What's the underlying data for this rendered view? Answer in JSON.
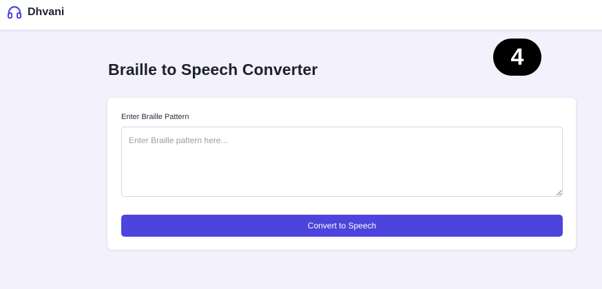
{
  "app": {
    "name": "Dhvani",
    "logo_icon": "headphones-icon",
    "accent_color": "#4c44dc"
  },
  "badge": {
    "text": "4"
  },
  "main": {
    "title": "Braille to Speech Converter",
    "form": {
      "label": "Enter Braille Pattern",
      "input_value": "",
      "input_placeholder": "Enter Braille pattern here...",
      "submit_label": "Convert to Speech"
    }
  }
}
